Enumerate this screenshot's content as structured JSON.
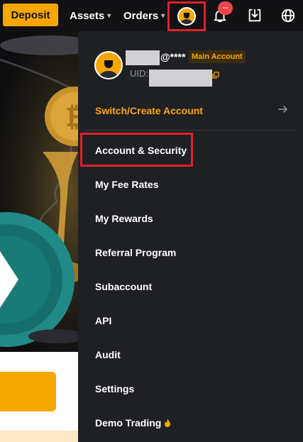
{
  "topbar": {
    "deposit_label": "Deposit",
    "assets_label": "Assets",
    "orders_label": "Orders",
    "notification_count": "···"
  },
  "profile": {
    "email_suffix": "@****",
    "account_badge": "Main Account",
    "uid_label": "UID:"
  },
  "switch_account_label": "Switch/Create Account",
  "menu": {
    "items": [
      "Account & Security",
      "My Fee Rates",
      "My Rewards",
      "Referral Program",
      "Subaccount",
      "API",
      "Audit",
      "Settings",
      "Demo Trading"
    ]
  },
  "colors": {
    "accent": "#f7a600",
    "highlight": "#e1202a",
    "panel": "#1f2023",
    "badge": "#ef454a"
  }
}
